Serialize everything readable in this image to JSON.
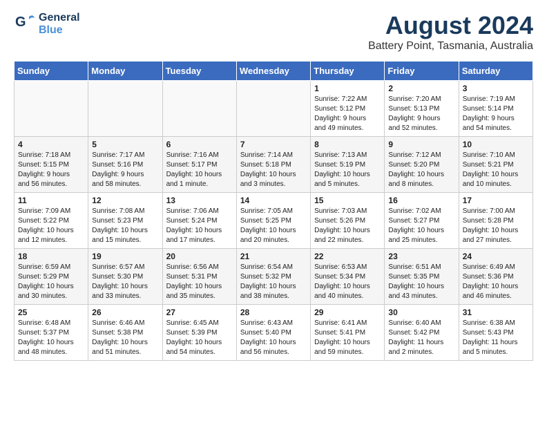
{
  "header": {
    "logo_general": "General",
    "logo_blue": "Blue",
    "month_year": "August 2024",
    "location": "Battery Point, Tasmania, Australia"
  },
  "weekdays": [
    "Sunday",
    "Monday",
    "Tuesday",
    "Wednesday",
    "Thursday",
    "Friday",
    "Saturday"
  ],
  "weeks": [
    [
      {
        "day": "",
        "info": ""
      },
      {
        "day": "",
        "info": ""
      },
      {
        "day": "",
        "info": ""
      },
      {
        "day": "",
        "info": ""
      },
      {
        "day": "1",
        "info": "Sunrise: 7:22 AM\nSunset: 5:12 PM\nDaylight: 9 hours\nand 49 minutes."
      },
      {
        "day": "2",
        "info": "Sunrise: 7:20 AM\nSunset: 5:13 PM\nDaylight: 9 hours\nand 52 minutes."
      },
      {
        "day": "3",
        "info": "Sunrise: 7:19 AM\nSunset: 5:14 PM\nDaylight: 9 hours\nand 54 minutes."
      }
    ],
    [
      {
        "day": "4",
        "info": "Sunrise: 7:18 AM\nSunset: 5:15 PM\nDaylight: 9 hours\nand 56 minutes."
      },
      {
        "day": "5",
        "info": "Sunrise: 7:17 AM\nSunset: 5:16 PM\nDaylight: 9 hours\nand 58 minutes."
      },
      {
        "day": "6",
        "info": "Sunrise: 7:16 AM\nSunset: 5:17 PM\nDaylight: 10 hours\nand 1 minute."
      },
      {
        "day": "7",
        "info": "Sunrise: 7:14 AM\nSunset: 5:18 PM\nDaylight: 10 hours\nand 3 minutes."
      },
      {
        "day": "8",
        "info": "Sunrise: 7:13 AM\nSunset: 5:19 PM\nDaylight: 10 hours\nand 5 minutes."
      },
      {
        "day": "9",
        "info": "Sunrise: 7:12 AM\nSunset: 5:20 PM\nDaylight: 10 hours\nand 8 minutes."
      },
      {
        "day": "10",
        "info": "Sunrise: 7:10 AM\nSunset: 5:21 PM\nDaylight: 10 hours\nand 10 minutes."
      }
    ],
    [
      {
        "day": "11",
        "info": "Sunrise: 7:09 AM\nSunset: 5:22 PM\nDaylight: 10 hours\nand 12 minutes."
      },
      {
        "day": "12",
        "info": "Sunrise: 7:08 AM\nSunset: 5:23 PM\nDaylight: 10 hours\nand 15 minutes."
      },
      {
        "day": "13",
        "info": "Sunrise: 7:06 AM\nSunset: 5:24 PM\nDaylight: 10 hours\nand 17 minutes."
      },
      {
        "day": "14",
        "info": "Sunrise: 7:05 AM\nSunset: 5:25 PM\nDaylight: 10 hours\nand 20 minutes."
      },
      {
        "day": "15",
        "info": "Sunrise: 7:03 AM\nSunset: 5:26 PM\nDaylight: 10 hours\nand 22 minutes."
      },
      {
        "day": "16",
        "info": "Sunrise: 7:02 AM\nSunset: 5:27 PM\nDaylight: 10 hours\nand 25 minutes."
      },
      {
        "day": "17",
        "info": "Sunrise: 7:00 AM\nSunset: 5:28 PM\nDaylight: 10 hours\nand 27 minutes."
      }
    ],
    [
      {
        "day": "18",
        "info": "Sunrise: 6:59 AM\nSunset: 5:29 PM\nDaylight: 10 hours\nand 30 minutes."
      },
      {
        "day": "19",
        "info": "Sunrise: 6:57 AM\nSunset: 5:30 PM\nDaylight: 10 hours\nand 33 minutes."
      },
      {
        "day": "20",
        "info": "Sunrise: 6:56 AM\nSunset: 5:31 PM\nDaylight: 10 hours\nand 35 minutes."
      },
      {
        "day": "21",
        "info": "Sunrise: 6:54 AM\nSunset: 5:32 PM\nDaylight: 10 hours\nand 38 minutes."
      },
      {
        "day": "22",
        "info": "Sunrise: 6:53 AM\nSunset: 5:34 PM\nDaylight: 10 hours\nand 40 minutes."
      },
      {
        "day": "23",
        "info": "Sunrise: 6:51 AM\nSunset: 5:35 PM\nDaylight: 10 hours\nand 43 minutes."
      },
      {
        "day": "24",
        "info": "Sunrise: 6:49 AM\nSunset: 5:36 PM\nDaylight: 10 hours\nand 46 minutes."
      }
    ],
    [
      {
        "day": "25",
        "info": "Sunrise: 6:48 AM\nSunset: 5:37 PM\nDaylight: 10 hours\nand 48 minutes."
      },
      {
        "day": "26",
        "info": "Sunrise: 6:46 AM\nSunset: 5:38 PM\nDaylight: 10 hours\nand 51 minutes."
      },
      {
        "day": "27",
        "info": "Sunrise: 6:45 AM\nSunset: 5:39 PM\nDaylight: 10 hours\nand 54 minutes."
      },
      {
        "day": "28",
        "info": "Sunrise: 6:43 AM\nSunset: 5:40 PM\nDaylight: 10 hours\nand 56 minutes."
      },
      {
        "day": "29",
        "info": "Sunrise: 6:41 AM\nSunset: 5:41 PM\nDaylight: 10 hours\nand 59 minutes."
      },
      {
        "day": "30",
        "info": "Sunrise: 6:40 AM\nSunset: 5:42 PM\nDaylight: 11 hours\nand 2 minutes."
      },
      {
        "day": "31",
        "info": "Sunrise: 6:38 AM\nSunset: 5:43 PM\nDaylight: 11 hours\nand 5 minutes."
      }
    ]
  ]
}
